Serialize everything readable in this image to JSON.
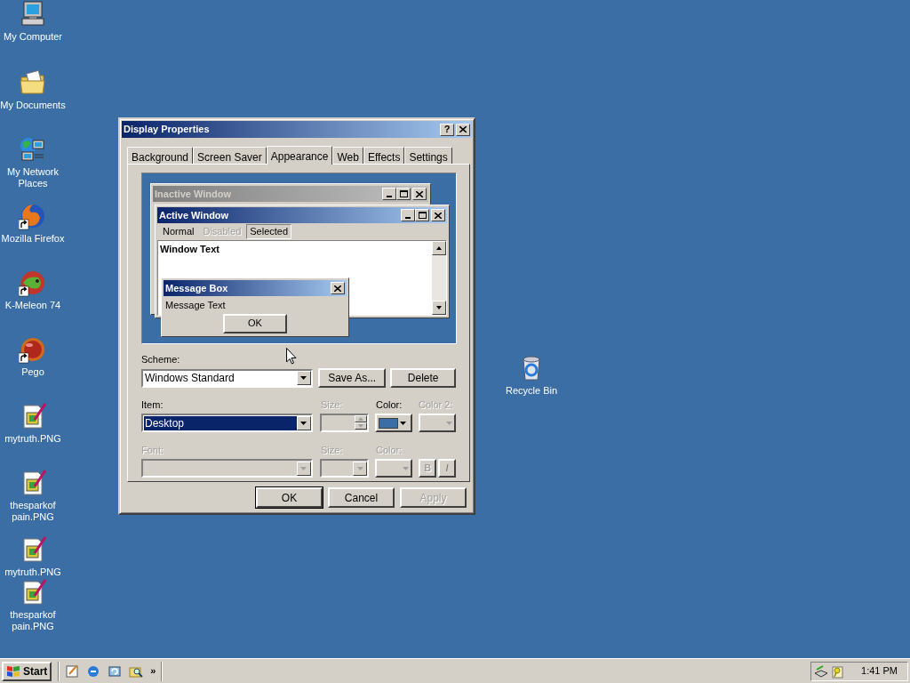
{
  "desktop": {
    "icons": [
      {
        "label": "My Computer",
        "kind": "computer",
        "shortcut": false
      },
      {
        "label": "My Documents",
        "kind": "folder",
        "shortcut": false
      },
      {
        "label": "My Network Places",
        "kind": "network",
        "shortcut": false
      },
      {
        "label": "Mozilla Firefox",
        "kind": "firefox",
        "shortcut": true
      },
      {
        "label": "K-Meleon 74",
        "kind": "kmeleon",
        "shortcut": true
      },
      {
        "label": "Pego",
        "kind": "ball",
        "shortcut": true
      },
      {
        "label": "mytruth.PNG",
        "kind": "image",
        "shortcut": false
      },
      {
        "label": "thesparkof pain.PNG",
        "kind": "image",
        "shortcut": false
      },
      {
        "label": "mytruth.PNG",
        "kind": "image",
        "shortcut": false
      },
      {
        "label": "thesparkof pain.PNG",
        "kind": "image",
        "shortcut": false
      },
      {
        "label": "Recycle Bin",
        "kind": "recycle",
        "shortcut": false
      }
    ]
  },
  "dialog": {
    "title": "Display Properties",
    "help": "?",
    "tabs": [
      {
        "label": "Background",
        "selected": false
      },
      {
        "label": "Screen Saver",
        "selected": false
      },
      {
        "label": "Appearance",
        "selected": true
      },
      {
        "label": "Web",
        "selected": false
      },
      {
        "label": "Effects",
        "selected": false
      },
      {
        "label": "Settings",
        "selected": false
      }
    ],
    "preview": {
      "inactive_title": "Inactive Window",
      "active_title": "Active Window",
      "menu": [
        {
          "label": "Normal",
          "disabled": false,
          "selected": false
        },
        {
          "label": "Disabled",
          "disabled": true,
          "selected": false
        },
        {
          "label": "Selected",
          "disabled": false,
          "selected": true
        }
      ],
      "window_text": "Window Text",
      "message_title": "Message Box",
      "message_text": "Message Text",
      "message_button": "OK"
    },
    "scheme": {
      "label": "Scheme:",
      "value": "Windows Standard",
      "buttons": [
        "Save As...",
        "Delete"
      ]
    },
    "item": {
      "label": "Item:",
      "value": "Desktop",
      "size_label": "Size:",
      "color_label": "Color:",
      "color": "#3a6ea5",
      "color2_label": "Color 2:"
    },
    "font": {
      "label": "Font:",
      "size_label": "Size:",
      "color_label": "Color:",
      "bold": "B",
      "italic": "I"
    },
    "buttons": [
      {
        "label": "OK",
        "disabled": false
      },
      {
        "label": "Cancel",
        "disabled": false
      },
      {
        "label": "Apply",
        "disabled": true
      }
    ]
  },
  "taskbar": {
    "start": "Start",
    "more": "»",
    "time": "1:41 PM"
  }
}
